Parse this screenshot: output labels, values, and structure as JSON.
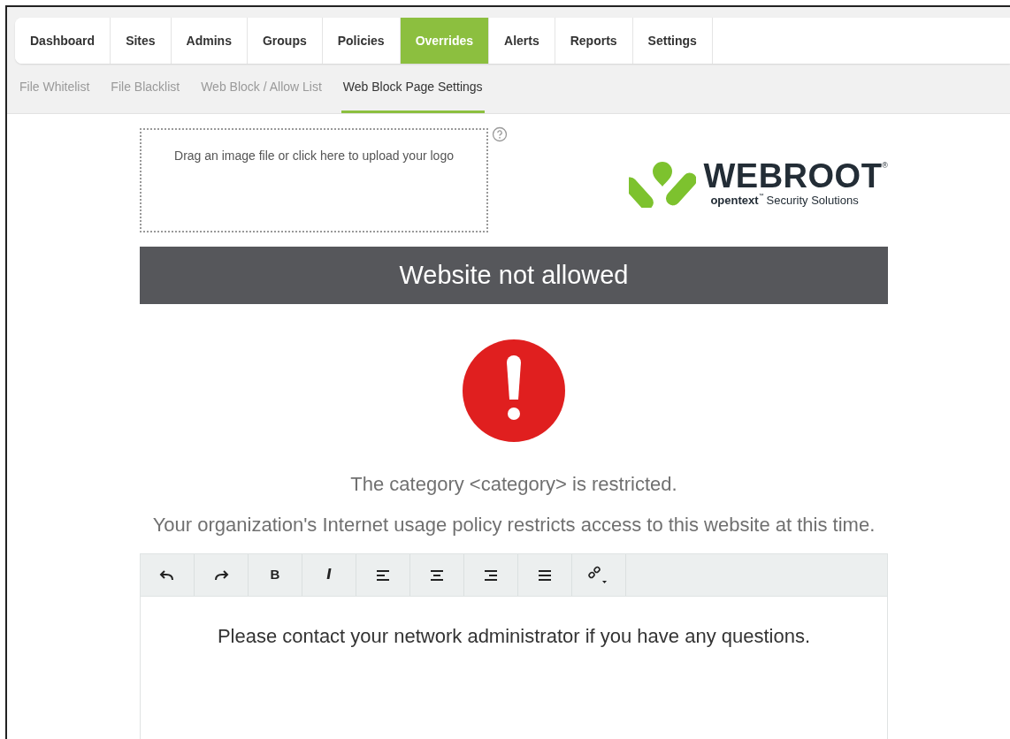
{
  "tabs": [
    {
      "label": "Dashboard",
      "selected": false
    },
    {
      "label": "Sites",
      "selected": false
    },
    {
      "label": "Admins",
      "selected": false
    },
    {
      "label": "Groups",
      "selected": false
    },
    {
      "label": "Policies",
      "selected": false
    },
    {
      "label": "Overrides",
      "selected": true
    },
    {
      "label": "Alerts",
      "selected": false
    },
    {
      "label": "Reports",
      "selected": false
    },
    {
      "label": "Settings",
      "selected": false
    }
  ],
  "subtabs": [
    {
      "label": "File Whitelist",
      "selected": false
    },
    {
      "label": "File Blacklist",
      "selected": false
    },
    {
      "label": "Web Block / Allow List",
      "selected": false
    },
    {
      "label": "Web Block Page Settings",
      "selected": true
    }
  ],
  "upload": {
    "text": "Drag an image file or click here to upload your logo"
  },
  "logo": {
    "name": "WEBROOT",
    "mark": "®",
    "company": "opentext",
    "tm": "™",
    "tagline": "Security Solutions"
  },
  "banner": {
    "title": "Website not allowed"
  },
  "messages": [
    "The category <category> is restricted.",
    "Your organization's Internet usage policy restricts access to this website at this time."
  ],
  "toolbar": [
    {
      "kind": "undo"
    },
    {
      "kind": "redo"
    },
    {
      "kind": "bold",
      "label": "B"
    },
    {
      "kind": "italic",
      "label": "I"
    },
    {
      "kind": "align-left"
    },
    {
      "kind": "align-center"
    },
    {
      "kind": "align-right"
    },
    {
      "kind": "justify"
    },
    {
      "kind": "link"
    }
  ],
  "editor": {
    "text": "Please contact your network administrator if you have any questions."
  }
}
